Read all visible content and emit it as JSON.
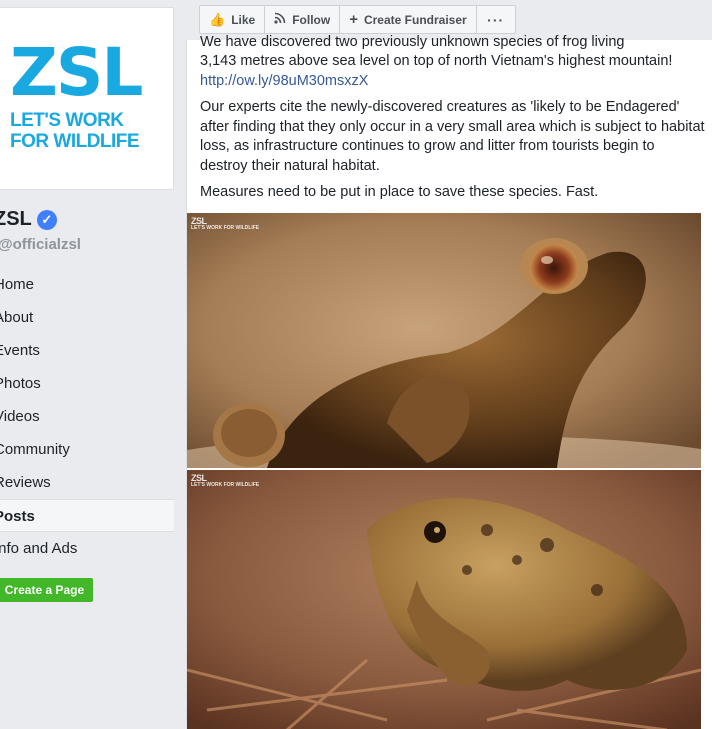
{
  "sidebar": {
    "logo": {
      "big": "ZSL",
      "line1": "LET'S WORK",
      "line2": "FOR WILDLIFE"
    },
    "page_name": "ZSL",
    "handle": "@officialzsl",
    "nav": [
      {
        "label": "Home"
      },
      {
        "label": "About"
      },
      {
        "label": "Events"
      },
      {
        "label": "Photos"
      },
      {
        "label": "Videos"
      },
      {
        "label": "Community"
      },
      {
        "label": "Reviews"
      },
      {
        "label": "Posts"
      },
      {
        "label": "Info and Ads"
      }
    ],
    "create_page": "Create a Page"
  },
  "action_bar": {
    "like": "Like",
    "follow": "Follow",
    "fundraiser": "Create Fundraiser",
    "more": "···"
  },
  "post": {
    "cut_line": "We have discovered two previously unknown species of frog living",
    "line2": "3,143 metres above sea level on top of north Vietnam's highest mountain!",
    "link": "http://ow.ly/98uM30msxzX",
    "para2": "Our experts cite the newly-discovered creatures as 'likely to be Endagered' after finding that they only occur in a very small area which is subject to habitat loss, as infrastructure continues to grow and litter from tourists begin to destroy their natural habitat.",
    "para3": "Measures need to be put in place to save these species. Fast.",
    "watermark_big": "ZSL",
    "watermark_small": "LET'S WORK FOR WILDLIFE"
  },
  "colors": {
    "brand": "#1aa8e1",
    "link": "#365899",
    "create_button": "#42b72a",
    "verified": "#4080ff"
  }
}
